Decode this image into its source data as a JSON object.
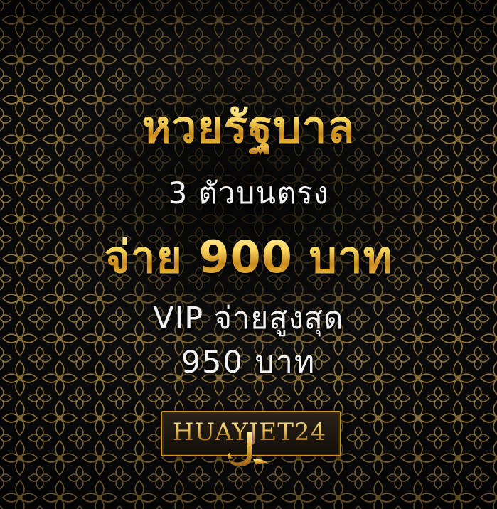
{
  "banner": {
    "headline": "หวยรัฐบาล",
    "subtitle": "3 ตัวบนตรง",
    "payout": "จ่าย 900 บาท",
    "vip_line": "VIP  จ่ายสูงสุด",
    "vip_amount": "950  บาท"
  },
  "logo": {
    "text": "HUAYJET24"
  },
  "colors": {
    "background": "#0d0d0d",
    "pattern": "#b8944a",
    "gold": "#f2c24a",
    "silver": "#f2f2f2"
  }
}
